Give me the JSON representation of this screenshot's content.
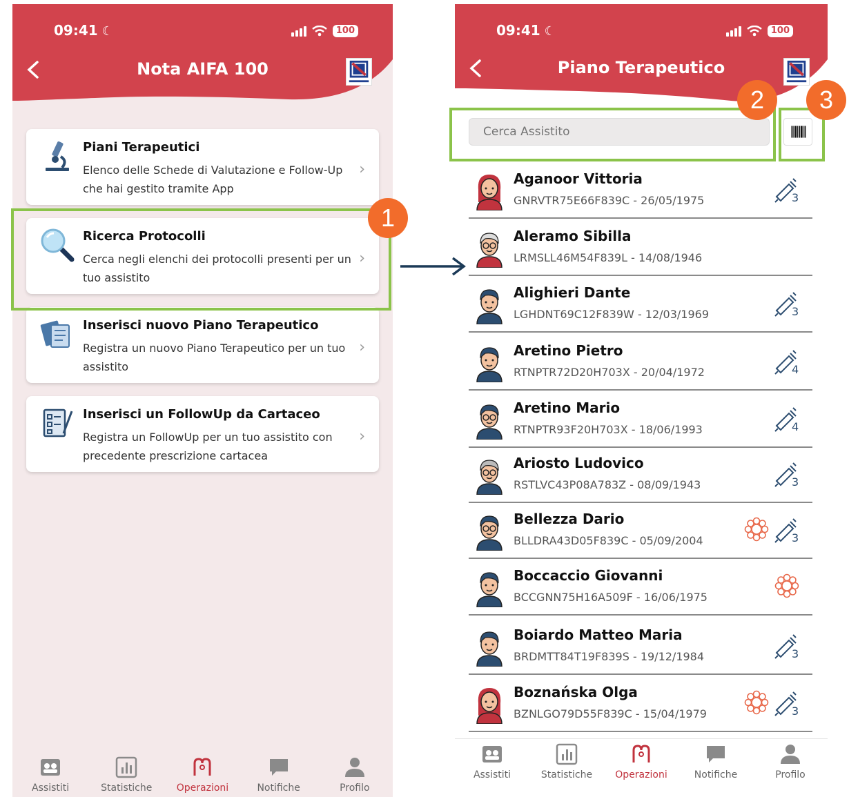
{
  "status_bar": {
    "time": "09:41",
    "battery": "100"
  },
  "left_screen": {
    "title": "Nota AIFA 100",
    "menu": [
      {
        "title": "Piani Terapeutici",
        "desc": "Elenco delle Schede di Valutazione e Follow-Up che hai gestito tramite App",
        "icon": "microscope-icon"
      },
      {
        "title": "Ricerca Protocolli",
        "desc": "Cerca negli elenchi dei protocolli presenti per un tuo assistito",
        "icon": "magnifier-icon"
      },
      {
        "title": "Inserisci nuovo Piano Terapeutico",
        "desc": "Registra un nuovo Piano Terapeutico per un tuo assistito",
        "icon": "documents-icon"
      },
      {
        "title": "Inserisci un FollowUp da Cartaceo",
        "desc": "Registra un FollowUp per un tuo assistito con precedente prescrizione cartacea",
        "icon": "checklist-icon"
      }
    ]
  },
  "right_screen": {
    "title": "Piano Terapeutico",
    "search_placeholder": "Cerca Assistito",
    "patients": [
      {
        "name": "Aganoor Vittoria",
        "meta": "GNRVTR75E66F839C - 26/05/1975",
        "gender": "f",
        "pen": "3",
        "virus": false
      },
      {
        "name": "Aleramo Sibilla",
        "meta": "LRMSLL46M54F839L - 14/08/1946",
        "gender": "old-f",
        "pen": "",
        "virus": false
      },
      {
        "name": "Alighieri Dante",
        "meta": "LGHDNT69C12F839W - 12/03/1969",
        "gender": "m",
        "pen": "3",
        "virus": false
      },
      {
        "name": "Aretino Pietro",
        "meta": "RTNPTR72D20H703X - 20/04/1972",
        "gender": "m",
        "pen": "4",
        "virus": false
      },
      {
        "name": "Aretino Mario",
        "meta": "RTNPTR93F20H703X - 18/06/1993",
        "gender": "m-glasses",
        "pen": "4",
        "virus": false
      },
      {
        "name": "Ariosto Ludovico",
        "meta": "RSTLVC43P08A783Z - 08/09/1943",
        "gender": "old-m",
        "pen": "3",
        "virus": false
      },
      {
        "name": "Bellezza Dario",
        "meta": "BLLDRA43D05F839C - 05/09/2004",
        "gender": "m-glasses",
        "pen": "3",
        "virus": true
      },
      {
        "name": "Boccaccio Giovanni",
        "meta": "BCCGNN75H16A509F - 16/06/1975",
        "gender": "m",
        "pen": "",
        "virus": true
      },
      {
        "name": "Boiardo Matteo Maria",
        "meta": "BRDMTT84T19F839S - 19/12/1984",
        "gender": "m",
        "pen": "3",
        "virus": false
      },
      {
        "name": "Boznańska Olga",
        "meta": "BZNLGO79D55F839C - 15/04/1979",
        "gender": "f",
        "pen": "3",
        "virus": true
      }
    ]
  },
  "tabs": [
    {
      "label": "Assistiti",
      "icon": "patients-icon"
    },
    {
      "label": "Statistiche",
      "icon": "chart-icon"
    },
    {
      "label": "Operazioni",
      "icon": "stethoscope-icon",
      "active": true
    },
    {
      "label": "Notifiche",
      "icon": "chat-bubble-icon"
    },
    {
      "label": "Profilo",
      "icon": "user-icon"
    }
  ],
  "annotations": {
    "n1": "1",
    "n2": "2",
    "n3": "3"
  },
  "colors": {
    "brand_red": "#d2434d",
    "highlight_green": "#8bc34a",
    "badge_orange": "#f26c2b",
    "arrow_navy": "#1b3a57"
  }
}
